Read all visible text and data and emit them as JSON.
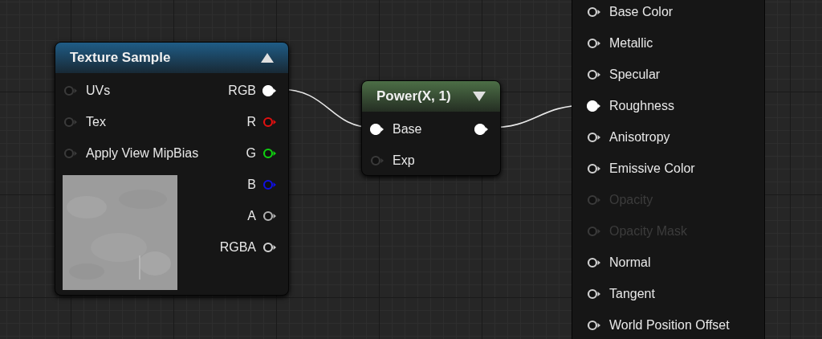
{
  "nodes": [
    {
      "kind": "texture",
      "title": "Texture Sample",
      "inputs": [
        {
          "label": "UVs",
          "connected": false,
          "disabled": false,
          "color": "#3a3a3a"
        },
        {
          "label": "Tex",
          "connected": false,
          "disabled": false,
          "color": "#3a3a3a"
        },
        {
          "label": "Apply View MipBias",
          "connected": false,
          "disabled": false,
          "color": "#3a3a3a"
        }
      ],
      "outputs": [
        {
          "label": "RGB",
          "connected": true,
          "disabled": false,
          "color": "#ffffff"
        },
        {
          "label": "R",
          "connected": false,
          "disabled": false,
          "color": "#e01010"
        },
        {
          "label": "G",
          "connected": false,
          "disabled": false,
          "color": "#10d010"
        },
        {
          "label": "B",
          "connected": false,
          "disabled": false,
          "color": "#1010e0"
        },
        {
          "label": "A",
          "connected": false,
          "disabled": false,
          "color": "#b0b0b0"
        },
        {
          "label": "RGBA",
          "connected": false,
          "disabled": false,
          "color": "#d0d0d0"
        }
      ]
    },
    {
      "kind": "math",
      "title": "Power(X, 1)",
      "inputs": [
        {
          "label": "Base",
          "connected": true,
          "disabled": false,
          "color": "#ffffff"
        },
        {
          "label": "Exp",
          "connected": false,
          "disabled": false,
          "color": "#3a3a3a"
        }
      ],
      "outputs": [
        {
          "connected": true,
          "disabled": false,
          "color": "#ffffff"
        }
      ]
    },
    {
      "kind": "result",
      "inputs": [
        {
          "label": "Base Color",
          "connected": false,
          "disabled": false,
          "color": "#d0d0d0"
        },
        {
          "label": "Metallic",
          "connected": false,
          "disabled": false,
          "color": "#d0d0d0"
        },
        {
          "label": "Specular",
          "connected": false,
          "disabled": false,
          "color": "#d0d0d0"
        },
        {
          "label": "Roughness",
          "connected": true,
          "disabled": false,
          "color": "#ffffff"
        },
        {
          "label": "Anisotropy",
          "connected": false,
          "disabled": false,
          "color": "#d0d0d0"
        },
        {
          "label": "Emissive Color",
          "connected": false,
          "disabled": false,
          "color": "#d0d0d0"
        },
        {
          "label": "Opacity",
          "connected": false,
          "disabled": true,
          "color": "#3a3a3a"
        },
        {
          "label": "Opacity Mask",
          "connected": false,
          "disabled": true,
          "color": "#3a3a3a"
        },
        {
          "label": "Normal",
          "connected": false,
          "disabled": false,
          "color": "#d0d0d0"
        },
        {
          "label": "Tangent",
          "connected": false,
          "disabled": false,
          "color": "#d0d0d0"
        },
        {
          "label": "World Position Offset",
          "connected": false,
          "disabled": false,
          "color": "#d0d0d0"
        }
      ]
    }
  ]
}
